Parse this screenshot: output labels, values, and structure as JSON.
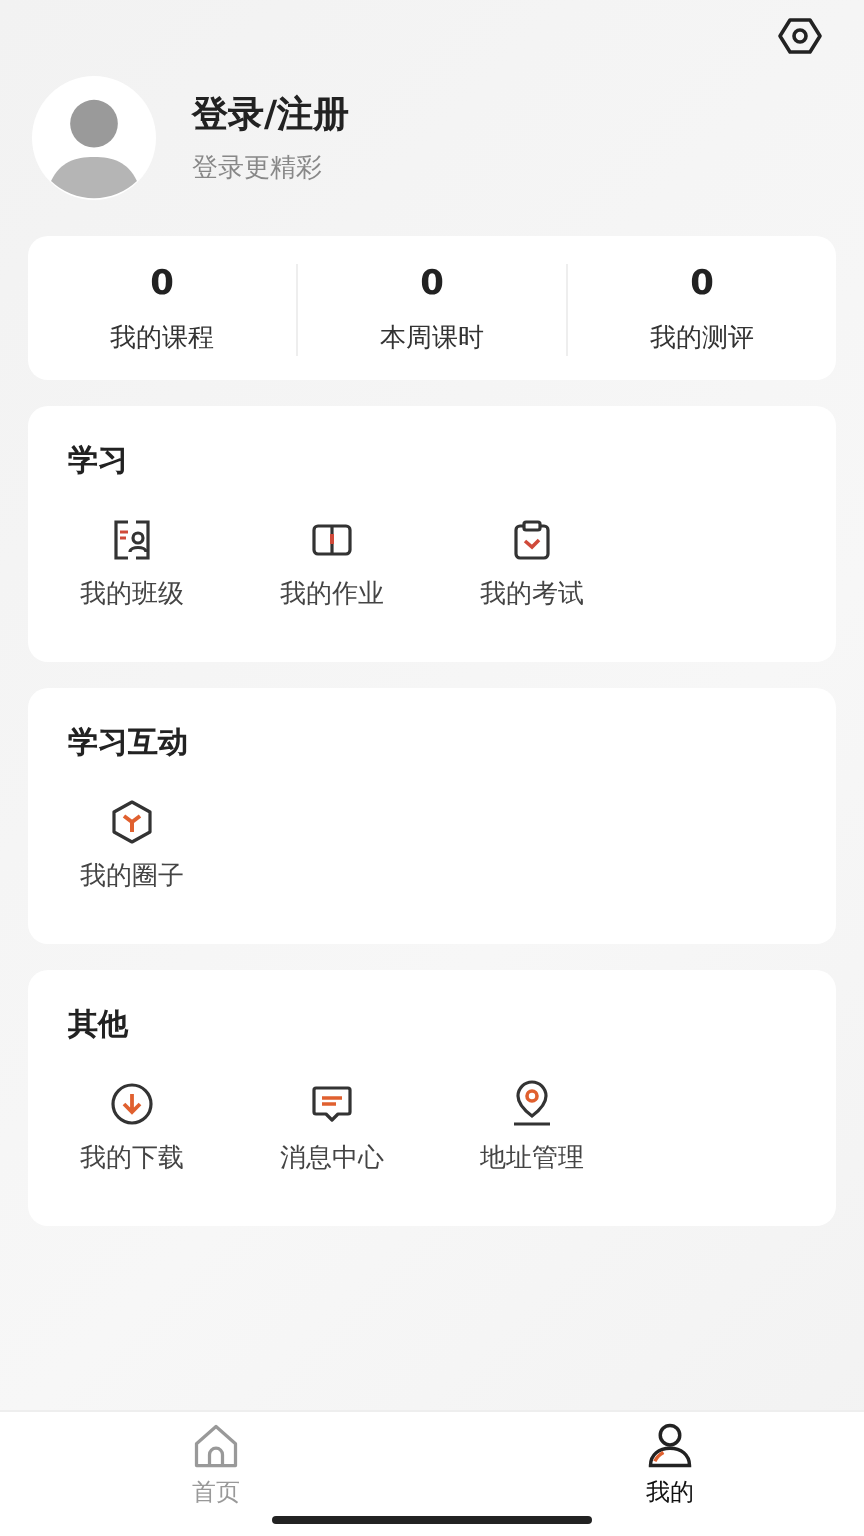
{
  "profile": {
    "name": "登录/注册",
    "subtitle": "登录更精彩"
  },
  "stats": [
    {
      "value": "0",
      "label": "我的课程"
    },
    {
      "value": "0",
      "label": "本周课时"
    },
    {
      "value": "0",
      "label": "我的测评"
    }
  ],
  "sections": [
    {
      "title": "学习",
      "items": [
        {
          "kind": "class",
          "label": "我的班级"
        },
        {
          "kind": "homework",
          "label": "我的作业"
        },
        {
          "kind": "exam",
          "label": "我的考试"
        }
      ]
    },
    {
      "title": "学习互动",
      "items": [
        {
          "kind": "circle",
          "label": "我的圈子"
        }
      ]
    },
    {
      "title": "其他",
      "items": [
        {
          "kind": "download",
          "label": "我的下载"
        },
        {
          "kind": "message",
          "label": "消息中心"
        },
        {
          "kind": "address",
          "label": "地址管理"
        }
      ]
    }
  ],
  "tabs": [
    {
      "kind": "home",
      "label": "首页",
      "selected": false
    },
    {
      "kind": "me",
      "label": "我的",
      "selected": true
    }
  ]
}
